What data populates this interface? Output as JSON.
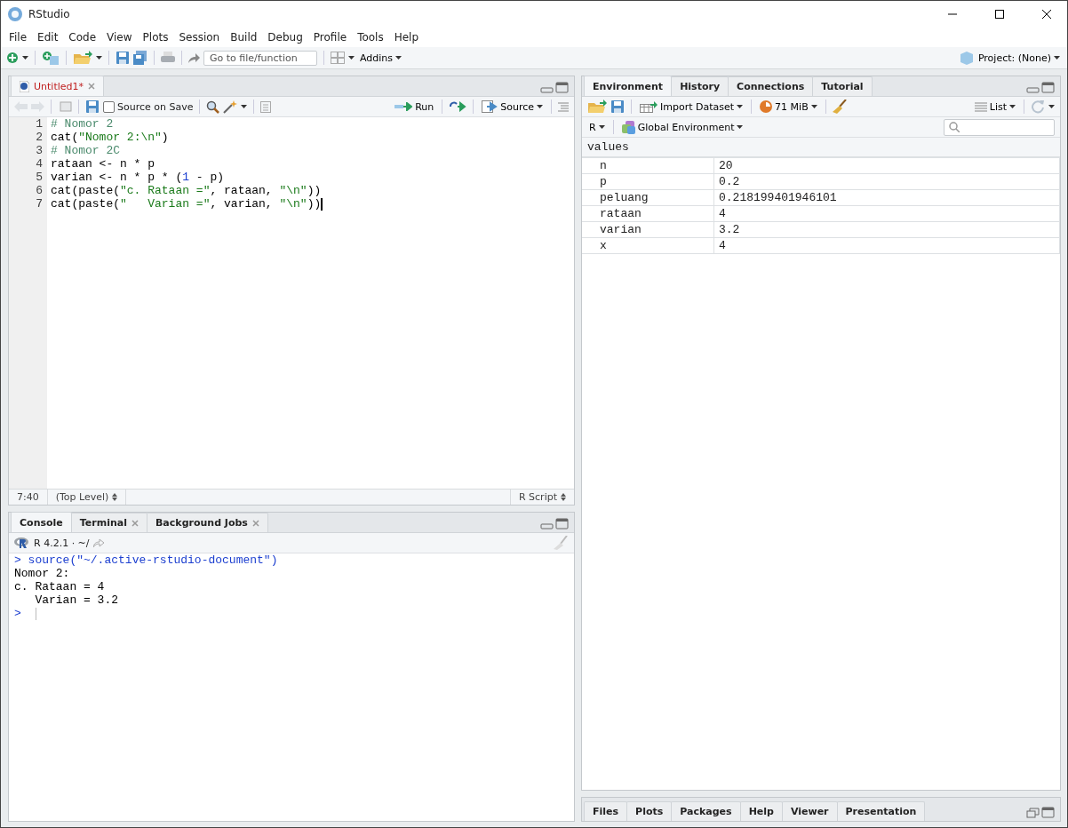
{
  "window": {
    "title": "RStudio"
  },
  "menu": [
    "File",
    "Edit",
    "Code",
    "View",
    "Plots",
    "Session",
    "Build",
    "Debug",
    "Profile",
    "Tools",
    "Help"
  ],
  "toolbar": {
    "goto_placeholder": "Go to file/function",
    "addins": "Addins",
    "project": "Project: (None)"
  },
  "source_pane": {
    "tabs": [
      {
        "label": "Untitled1*",
        "modified": true,
        "closable": true,
        "selected": true
      }
    ],
    "toolbar": {
      "source_on_save": {
        "label": "Source on Save",
        "checked": false
      },
      "run": "Run",
      "source": "Source"
    },
    "lines": [
      {
        "number": "1",
        "tokens": [
          {
            "kind": "comment",
            "text": "# Nomor 2"
          }
        ]
      },
      {
        "number": "2",
        "tokens": [
          {
            "kind": "plain",
            "text": "cat("
          },
          {
            "kind": "string",
            "text": "\"Nomor 2:\\n\""
          },
          {
            "kind": "plain",
            "text": ")"
          }
        ]
      },
      {
        "number": "3",
        "tokens": [
          {
            "kind": "comment",
            "text": "# Nomor 2C"
          }
        ]
      },
      {
        "number": "4",
        "tokens": [
          {
            "kind": "plain",
            "text": "rataan <- n * p"
          }
        ]
      },
      {
        "number": "5",
        "tokens": [
          {
            "kind": "plain",
            "text": "varian <- n * p * ("
          },
          {
            "kind": "number",
            "text": "1"
          },
          {
            "kind": "plain",
            "text": " - p)"
          }
        ]
      },
      {
        "number": "6",
        "tokens": [
          {
            "kind": "plain",
            "text": "cat(paste("
          },
          {
            "kind": "string",
            "text": "\"c. Rataan =\""
          },
          {
            "kind": "plain",
            "text": ", rataan, "
          },
          {
            "kind": "string",
            "text": "\"\\n\""
          },
          {
            "kind": "plain",
            "text": "))"
          }
        ]
      },
      {
        "number": "7",
        "tokens": [
          {
            "kind": "plain",
            "text": "cat(paste("
          },
          {
            "kind": "string",
            "text": "\"   Varian =\""
          },
          {
            "kind": "plain",
            "text": ", varian, "
          },
          {
            "kind": "string",
            "text": "\"\\n\""
          },
          {
            "kind": "plain",
            "text": "))"
          }
        ]
      }
    ],
    "status": {
      "position": "7:40",
      "scope": "(Top Level)",
      "filetype": "R Script"
    }
  },
  "console_pane": {
    "tabs": [
      {
        "label": "Console",
        "selected": true,
        "closable": false
      },
      {
        "label": "Terminal",
        "selected": false,
        "closable": true
      },
      {
        "label": "Background Jobs",
        "selected": false,
        "closable": true
      }
    ],
    "info": "R 4.2.1 · ~/",
    "lines": [
      {
        "kind": "input",
        "prompt": ">",
        "text": "source(\"~/.active-rstudio-document\")"
      },
      {
        "kind": "output",
        "text": "Nomor 2:"
      },
      {
        "kind": "output",
        "text": "c. Rataan = 4"
      },
      {
        "kind": "output",
        "text": "   Varian = 3.2"
      },
      {
        "kind": "prompt",
        "prompt": ">"
      }
    ]
  },
  "environment_pane": {
    "tabs": [
      {
        "label": "Environment",
        "selected": true
      },
      {
        "label": "History",
        "selected": false
      },
      {
        "label": "Connections",
        "selected": false
      },
      {
        "label": "Tutorial",
        "selected": false
      }
    ],
    "toolbar": {
      "import": "Import Dataset",
      "memory": "71 MiB",
      "view": "List",
      "language": "R",
      "scope": "Global Environment"
    },
    "section": "values",
    "rows": [
      {
        "name": "n",
        "value": "20"
      },
      {
        "name": "p",
        "value": "0.2"
      },
      {
        "name": "peluang",
        "value": "0.218199401946101"
      },
      {
        "name": "rataan",
        "value": "4"
      },
      {
        "name": "varian",
        "value": "3.2"
      },
      {
        "name": "x",
        "value": "4"
      }
    ]
  },
  "files_pane": {
    "tabs": [
      {
        "label": "Files",
        "selected": false
      },
      {
        "label": "Plots",
        "selected": false
      },
      {
        "label": "Packages",
        "selected": false
      },
      {
        "label": "Help",
        "selected": false
      },
      {
        "label": "Viewer",
        "selected": false
      },
      {
        "label": "Presentation",
        "selected": false
      }
    ]
  }
}
